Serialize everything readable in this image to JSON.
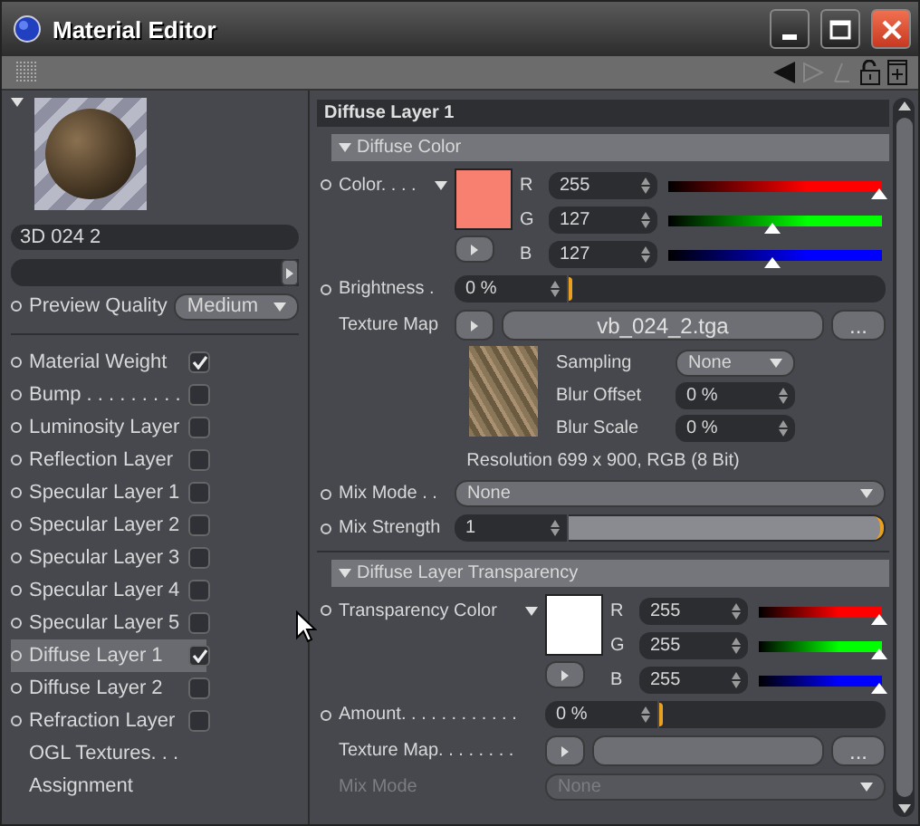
{
  "window": {
    "title": "Material Editor"
  },
  "left": {
    "material_name": "3D 024 2",
    "preview_quality": {
      "label": "Preview Quality",
      "value": "Medium"
    },
    "layers": [
      {
        "label": "Material Weight",
        "checked": true,
        "selected": false
      },
      {
        "label": "Bump . . . . . . . . .",
        "checked": false,
        "selected": false
      },
      {
        "label": "Luminosity Layer",
        "checked": false,
        "selected": false
      },
      {
        "label": "Reflection Layer",
        "checked": false,
        "selected": false
      },
      {
        "label": "Specular Layer 1",
        "checked": false,
        "selected": false
      },
      {
        "label": "Specular Layer 2",
        "checked": false,
        "selected": false
      },
      {
        "label": "Specular Layer 3",
        "checked": false,
        "selected": false
      },
      {
        "label": "Specular Layer 4",
        "checked": false,
        "selected": false
      },
      {
        "label": "Specular Layer 5",
        "checked": false,
        "selected": false
      },
      {
        "label": "Diffuse Layer 1",
        "checked": true,
        "selected": true
      },
      {
        "label": "Diffuse Layer 2",
        "checked": false,
        "selected": false
      },
      {
        "label": "Refraction Layer",
        "checked": false,
        "selected": false
      }
    ],
    "links": [
      "OGL Textures. . .",
      "Assignment"
    ]
  },
  "panel": {
    "title": "Diffuse Layer 1",
    "diffuse_color": {
      "title": "Diffuse Color",
      "color": {
        "label": "Color. . . .",
        "color": "#f88070",
        "channels": [
          {
            "name": "R",
            "value": "255",
            "level": 1,
            "color": "#ff0000"
          },
          {
            "name": "G",
            "value": "127",
            "level": 0.5,
            "color": "#00ff00"
          },
          {
            "name": "B",
            "value": "127",
            "level": 0.5,
            "color": "#0000ff"
          }
        ]
      },
      "brightness": {
        "label": "Brightness .",
        "value": "0 %",
        "level": 0
      },
      "texture_map": {
        "label": "Texture Map",
        "file": "vb_024_2.tga",
        "browse": "..."
      },
      "sampling": {
        "label": "Sampling",
        "value": "None"
      },
      "blur_offset": {
        "label": "Blur Offset",
        "value": "0 %"
      },
      "blur_scale": {
        "label": "Blur Scale",
        "value": "0 %"
      },
      "resolution": "Resolution 699 x 900, RGB (8 Bit)",
      "mix_mode": {
        "label": "Mix Mode . .",
        "value": "None",
        "disabled": false
      },
      "mix_strength": {
        "label": "Mix Strength",
        "value": "1",
        "level": 1
      }
    },
    "transparency": {
      "title": "Diffuse Layer Transparency",
      "color": {
        "label": "Transparency Color",
        "color": "#ffffff",
        "channels": [
          {
            "name": "R",
            "value": "255",
            "level": 1,
            "color": "#ff0000"
          },
          {
            "name": "G",
            "value": "255",
            "level": 1,
            "color": "#00ff00"
          },
          {
            "name": "B",
            "value": "255",
            "level": 1,
            "color": "#0000ff"
          }
        ]
      },
      "amount": {
        "label": "Amount. . . . . . . . . . . .",
        "value": "0 %",
        "level": 0
      },
      "texture_map": {
        "label": "Texture Map. . . . . . . .",
        "browse": "..."
      },
      "mix_mode": {
        "label": "Mix Mode",
        "value": "None",
        "disabled": true
      }
    }
  }
}
